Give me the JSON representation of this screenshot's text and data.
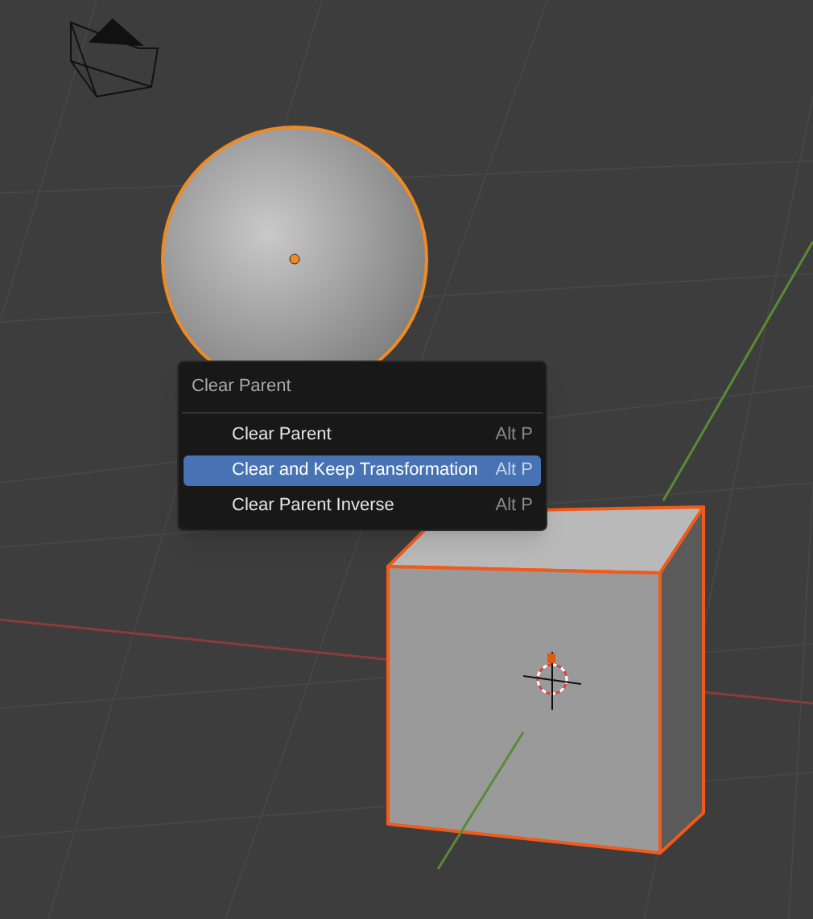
{
  "menu": {
    "title": "Clear Parent",
    "items": [
      {
        "label": "Clear Parent",
        "shortcut": "Alt P",
        "selected": false
      },
      {
        "label": "Clear and Keep Transformation",
        "shortcut": "Alt P",
        "selected": true
      },
      {
        "label": "Clear Parent Inverse",
        "shortcut": "Alt P",
        "selected": false
      }
    ]
  }
}
